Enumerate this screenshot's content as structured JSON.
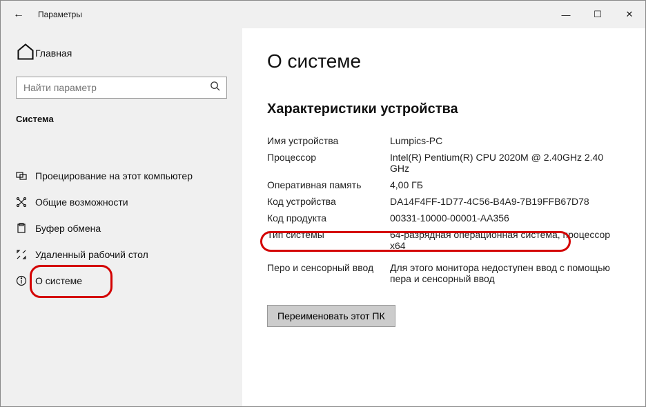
{
  "titlebar": {
    "back_icon": "←",
    "title": "Параметры",
    "min_icon": "—",
    "max_icon": "☐",
    "close_icon": "✕"
  },
  "sidebar": {
    "home_label": "Главная",
    "search_placeholder": "Найти параметр",
    "group_title": "Система",
    "items": [
      {
        "label": "Проецирование на этот компьютер"
      },
      {
        "label": "Общие возможности"
      },
      {
        "label": "Буфер обмена"
      },
      {
        "label": "Удаленный рабочий стол"
      },
      {
        "label": "О системе"
      }
    ]
  },
  "main": {
    "heading": "О системе",
    "section_title": "Характеристики устройства",
    "specs": [
      {
        "key": "Имя устройства",
        "val": "Lumpics-PC"
      },
      {
        "key": "Процессор",
        "val": "Intel(R) Pentium(R) CPU 2020M @ 2.40GHz 2.40 GHz"
      },
      {
        "key": "Оперативная память",
        "val": "4,00 ГБ"
      },
      {
        "key": "Код устройства",
        "val": "DA14F4FF-1D77-4C56-B4A9-7B19FFB67D78"
      },
      {
        "key": "Код продукта",
        "val": "00331-10000-00001-AA356"
      },
      {
        "key": "Тип системы",
        "val": "64-разрядная операционная система, процессор x64"
      },
      {
        "key": "Перо и сенсорный ввод",
        "val": "Для этого монитора недоступен ввод с помощью пера и сенсорный ввод"
      }
    ],
    "rename_button": "Переименовать этот ПК"
  }
}
